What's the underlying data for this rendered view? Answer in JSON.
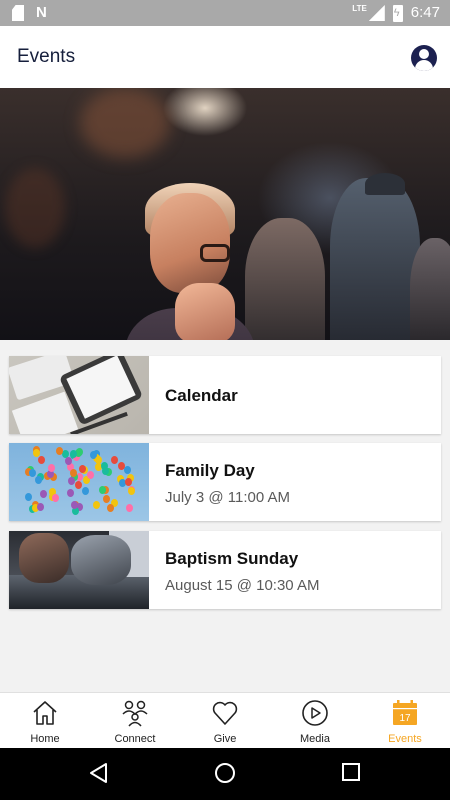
{
  "status_bar": {
    "network_label": "LTE",
    "time": "6:47",
    "icons": [
      "sd-card-icon",
      "n-notification-icon",
      "signal-icon",
      "battery-charging-icon"
    ]
  },
  "header": {
    "title": "Events",
    "profile_icon": "account-circle-icon"
  },
  "hero": {
    "image": "worship-crowd-photo"
  },
  "events": [
    {
      "title": "Calendar",
      "date": "",
      "thumbnail": "tablet-calendar-photo"
    },
    {
      "title": "Family Day",
      "date": "July 3 @ 11:00 AM",
      "thumbnail": "balloons-photo"
    },
    {
      "title": "Baptism Sunday",
      "date": "August 15 @ 10:30 AM",
      "thumbnail": "baptism-photo"
    }
  ],
  "bottom_nav": {
    "items": [
      {
        "label": "Home",
        "icon": "home-icon",
        "active": false
      },
      {
        "label": "Connect",
        "icon": "people-icon",
        "active": false
      },
      {
        "label": "Give",
        "icon": "heart-icon",
        "active": false
      },
      {
        "label": "Media",
        "icon": "play-circle-icon",
        "active": false
      },
      {
        "label": "Events",
        "icon": "calendar-icon",
        "active": true,
        "badge": "17"
      }
    ],
    "active_color": "#f5a623"
  },
  "system_nav": {
    "buttons": [
      "back-icon",
      "home-circle-icon",
      "recents-icon"
    ]
  }
}
